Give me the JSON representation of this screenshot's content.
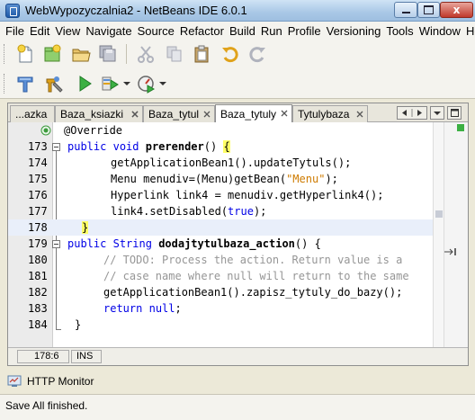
{
  "window": {
    "title": "WebWypozyczalnia2 - NetBeans IDE 6.0.1",
    "close_glyph": "x"
  },
  "menu": [
    "File",
    "Edit",
    "View",
    "Navigate",
    "Source",
    "Refactor",
    "Build",
    "Run",
    "Profile",
    "Versioning",
    "Tools",
    "Window",
    "Help"
  ],
  "toolbar1": [
    "new-file-icon",
    "new-project-icon",
    "open-project-icon",
    "save-all-icon",
    "cut-icon",
    "copy-icon",
    "paste-icon",
    "undo-icon",
    "redo-icon"
  ],
  "toolbar2": [
    "clean-build-icon",
    "build-icon",
    "run-icon",
    "debug-icon",
    "profile-icon"
  ],
  "tabs": [
    {
      "label": "...azka",
      "active": false
    },
    {
      "label": "Baza_ksiazki",
      "active": false
    },
    {
      "label": "Baza_tytul",
      "active": false
    },
    {
      "label": "Baza_tytuly",
      "active": true
    },
    {
      "label": "Tytulybaza",
      "active": false
    }
  ],
  "code_lines": [
    {
      "num": "",
      "text": "@Override"
    },
    {
      "num": "173",
      "text": "public void prerender() {"
    },
    {
      "num": "174",
      "text": "getApplicationBean1().updateTytuls();"
    },
    {
      "num": "175",
      "text": "Menu menudiv=(Menu)getBean(\"Menu\");"
    },
    {
      "num": "176",
      "text": "Hyperlink link4 = menudiv.getHyperlink4();"
    },
    {
      "num": "177",
      "text": "link4.setDisabled(true);"
    },
    {
      "num": "178",
      "text": "}"
    },
    {
      "num": "179",
      "text": "public String dodajtytulbaza_action() {"
    },
    {
      "num": "180",
      "text": "// TODO: Process the action. Return value is a"
    },
    {
      "num": "181",
      "text": "// case name where null will return to the same"
    },
    {
      "num": "182",
      "text": "getApplicationBean1().zapisz_tytuly_do_bazy();"
    },
    {
      "num": "183",
      "text": "return null;"
    },
    {
      "num": "184",
      "text": "}"
    }
  ],
  "status": {
    "position": "178:6",
    "mode": "INS"
  },
  "http_monitor": "HTTP Monitor",
  "status_message": "Save All finished.",
  "colors": {
    "keyword": "#0000e6",
    "string": "#ce7b00",
    "comment": "#969696",
    "brace_highlight": "#ffff66"
  }
}
